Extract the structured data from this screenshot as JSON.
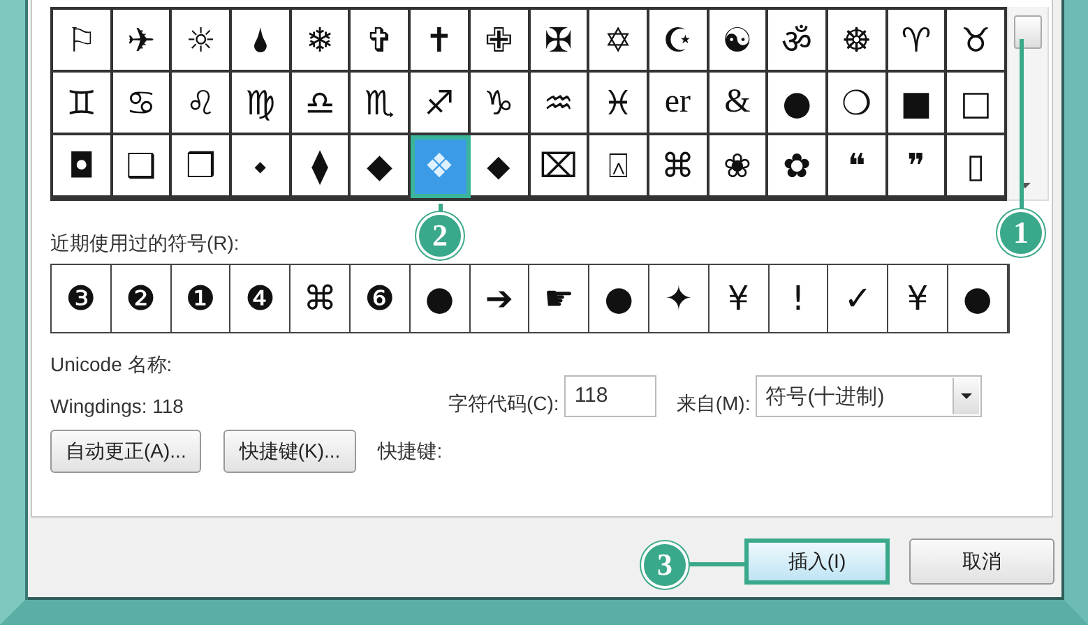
{
  "symbol_grid": {
    "rows": [
      [
        {
          "symbol": "⚐",
          "selected": false
        },
        {
          "symbol": "✈",
          "selected": false
        },
        {
          "symbol": "☼",
          "selected": false
        },
        {
          "symbol": "🌢",
          "selected": false
        },
        {
          "symbol": "❄",
          "selected": false
        },
        {
          "symbol": "✞",
          "selected": false
        },
        {
          "symbol": "✝",
          "selected": false
        },
        {
          "symbol": "✙",
          "selected": false
        },
        {
          "symbol": "✠",
          "selected": false
        },
        {
          "symbol": "✡",
          "selected": false
        },
        {
          "symbol": "☪",
          "selected": false
        },
        {
          "symbol": "☯",
          "selected": false
        },
        {
          "symbol": "ॐ",
          "selected": false
        },
        {
          "symbol": "☸",
          "selected": false
        },
        {
          "symbol": "♈",
          "selected": false
        },
        {
          "symbol": "♉",
          "selected": false
        }
      ],
      [
        {
          "symbol": "♊",
          "selected": false
        },
        {
          "symbol": "♋",
          "selected": false
        },
        {
          "symbol": "♌",
          "selected": false
        },
        {
          "symbol": "♍",
          "selected": false
        },
        {
          "symbol": "♎",
          "selected": false
        },
        {
          "symbol": "♏",
          "selected": false
        },
        {
          "symbol": "♐",
          "selected": false
        },
        {
          "symbol": "♑",
          "selected": false
        },
        {
          "symbol": "♒",
          "selected": false
        },
        {
          "symbol": "♓",
          "selected": false
        },
        {
          "symbol": "er",
          "selected": false
        },
        {
          "symbol": "&",
          "selected": false
        },
        {
          "symbol": "●",
          "selected": false
        },
        {
          "symbol": "❍",
          "selected": false
        },
        {
          "symbol": "■",
          "selected": false
        },
        {
          "symbol": "□",
          "selected": false
        }
      ],
      [
        {
          "symbol": "◘",
          "selected": false
        },
        {
          "symbol": "❑",
          "selected": false
        },
        {
          "symbol": "❒",
          "selected": false
        },
        {
          "symbol": "⬩",
          "selected": false
        },
        {
          "symbol": "⧫",
          "selected": false
        },
        {
          "symbol": "◆",
          "selected": false
        },
        {
          "symbol": "❖",
          "selected": true
        },
        {
          "symbol": "⬥",
          "selected": false
        },
        {
          "symbol": "⌧",
          "selected": false
        },
        {
          "symbol": "⍓",
          "selected": false
        },
        {
          "symbol": "⌘",
          "selected": false
        },
        {
          "symbol": "❀",
          "selected": false
        },
        {
          "symbol": "✿",
          "selected": false
        },
        {
          "symbol": "❝",
          "selected": false
        },
        {
          "symbol": "❞",
          "selected": false
        },
        {
          "symbol": "▯",
          "selected": false
        }
      ]
    ]
  },
  "recent_label": "近期使用过的符号(R):",
  "recent_symbols": [
    "❸",
    "❷",
    "❶",
    "❹",
    "⌘",
    "❻",
    "●",
    "➔",
    "☛",
    "●",
    "✦",
    "¥",
    "!",
    "✓",
    "¥",
    "●"
  ],
  "unicode_name_label": "Unicode 名称:",
  "char_name": "Wingdings: 118",
  "char_code": {
    "label": "字符代码(C):",
    "value": "118"
  },
  "from": {
    "label": "来自(M):",
    "value": "符号(十进制)"
  },
  "buttons": [
    {
      "label": "自动更正(A)..."
    },
    {
      "label": "快捷键(K)..."
    }
  ],
  "shortcut_label": "快捷键:",
  "dialog_buttons": [
    {
      "label": "插入(I)",
      "highlighted": true
    },
    {
      "label": "取消",
      "highlighted": false
    }
  ],
  "callouts": [
    {
      "number": "1"
    },
    {
      "number": "2"
    },
    {
      "number": "3"
    }
  ]
}
